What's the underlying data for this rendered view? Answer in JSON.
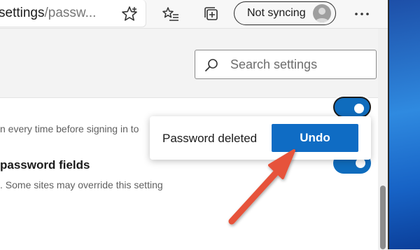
{
  "address_bar": {
    "url_host": "settings",
    "url_path": "/passw..."
  },
  "toolbar": {
    "favorite_icon": "star-outline-icon",
    "favorites_icon": "favorites-list-icon",
    "collections_icon": "collections-icon",
    "profile_label": "Not syncing",
    "more_icon": "ellipsis-icon"
  },
  "search": {
    "placeholder": "Search settings",
    "icon": "search-icon"
  },
  "settings": {
    "item1_description": "n every time before signing in to",
    "item1_toggle": "on",
    "item2_title": "password fields",
    "item2_description": ". Some sites may override this setting",
    "item2_toggle": "on"
  },
  "toast": {
    "message": "Password deleted",
    "undo_label": "Undo"
  },
  "colors": {
    "accent": "#0f6cbd",
    "undo_button": "#0f6cc4",
    "arrow": "#e6533a"
  }
}
